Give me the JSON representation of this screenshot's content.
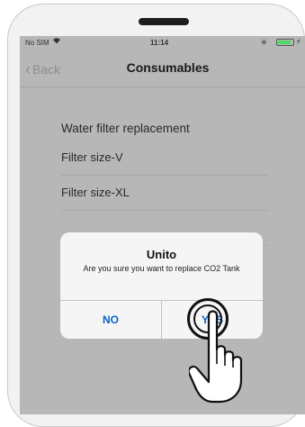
{
  "status_bar": {
    "carrier": "No SIM",
    "wifi_icon": "wifi-icon",
    "time": "11:14",
    "bluetooth_icon": "bluetooth-icon",
    "battery_icon": "battery-icon",
    "charging_icon": "bolt-icon"
  },
  "nav": {
    "back_label": "Back",
    "title": "Consumables"
  },
  "list": {
    "header": "Water filter replacement",
    "items": [
      "Filter size-V",
      "Filter size-XL"
    ]
  },
  "alert": {
    "title": "Unito",
    "message": "Are you sure you want to replace CO2 Tank",
    "no_label": "NO",
    "yes_label": "YES"
  },
  "colors": {
    "accent": "#0a62c9",
    "overlay": "#b7b7b7",
    "alert_bg": "#f5f5f5"
  }
}
